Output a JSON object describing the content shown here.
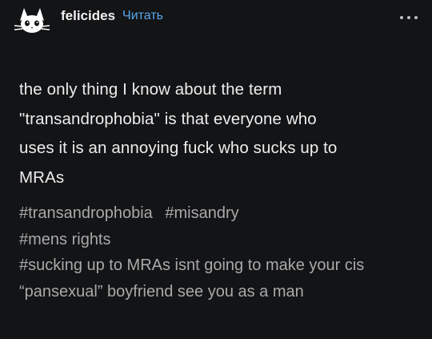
{
  "post": {
    "username": "felicides",
    "follow_label": "Читать",
    "more_icon": "more-horizontal-icon",
    "avatar_icon": "cat-avatar-icon",
    "body": "the only thing I know about the term\n\"transandrophobia\" is that everyone who\nuses it is an annoying fuck who sucks up to\nMRAs",
    "tags": [
      "#transandrophobia",
      "#misandry",
      "#mens rights",
      "#sucking up to MRAs isnt going to make your cis “pansexual” boyfriend see you as a man"
    ]
  },
  "colors": {
    "background": "#131416",
    "text": "#ededed",
    "tag_text": "#a9a9a9",
    "link": "#5aa7e8"
  }
}
